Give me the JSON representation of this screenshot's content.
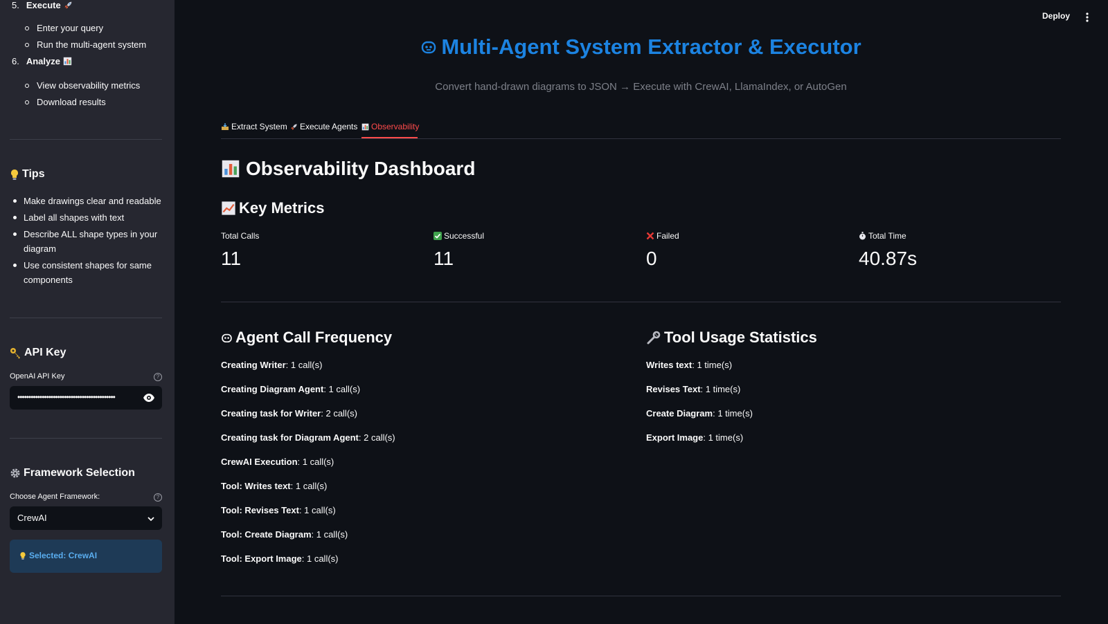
{
  "sidebar": {
    "steps": [
      {
        "num": "5.",
        "label": "Execute",
        "icon": "rocket-icon",
        "subs": [
          "Enter your query",
          "Run the multi-agent system"
        ]
      },
      {
        "num": "6.",
        "label": "Analyze",
        "icon": "bar-chart-icon",
        "subs": [
          "View observability metrics",
          "Download results"
        ]
      }
    ],
    "tips": {
      "title": "Tips",
      "icon": "lightbulb-icon",
      "items": [
        "Make drawings clear and readable",
        "Label all shapes with text",
        "Describe ALL shape types in your diagram",
        "Use consistent shapes for same components"
      ]
    },
    "api_key": {
      "title": "API Key",
      "icon": "key-icon",
      "label": "OpenAI API Key",
      "masked_value": "••••••••••••••••••••••••••••••••••••••••••••"
    },
    "framework": {
      "title": "Framework Selection",
      "icon": "gear-icon",
      "label": "Choose Agent Framework:",
      "selected": "CrewAI",
      "info": "Selected: CrewAI"
    }
  },
  "header": {
    "deploy_label": "Deploy"
  },
  "main": {
    "title": "Multi-Agent System Extractor & Executor",
    "subtitle": "Convert hand-drawn diagrams to JSON → Execute with CrewAI, LlamaIndex, or AutoGen",
    "tabs": [
      {
        "label": "Extract System",
        "icon": "inbox-tray-icon",
        "active": false
      },
      {
        "label": "Execute Agents",
        "icon": "rocket-icon",
        "active": false
      },
      {
        "label": "Observability",
        "icon": "bar-chart-icon",
        "active": true
      }
    ],
    "dashboard_title": "Observability Dashboard",
    "key_metrics_title": "Key Metrics",
    "metrics": [
      {
        "label": "Total Calls",
        "value": "11",
        "icon": ""
      },
      {
        "label": "Successful",
        "value": "11",
        "icon": "check-icon"
      },
      {
        "label": "Failed",
        "value": "0",
        "icon": "cross-icon"
      },
      {
        "label": "Total Time",
        "value": "40.87s",
        "icon": "stopwatch-icon"
      }
    ],
    "agent_freq_title": "Agent Call Frequency",
    "agent_calls": [
      {
        "name": "Creating Writer",
        "value": ": 1 call(s)"
      },
      {
        "name": "Creating Diagram Agent",
        "value": ": 1 call(s)"
      },
      {
        "name": "Creating task for Writer",
        "value": ": 2 call(s)"
      },
      {
        "name": "Creating task for Diagram Agent",
        "value": ": 2 call(s)"
      },
      {
        "name": "CrewAI Execution",
        "value": ": 1 call(s)"
      },
      {
        "name": "Tool: Writes text",
        "value": ": 1 call(s)"
      },
      {
        "name": "Tool: Revises Text",
        "value": ": 1 call(s)"
      },
      {
        "name": "Tool: Create Diagram",
        "value": ": 1 call(s)"
      },
      {
        "name": "Tool: Export Image",
        "value": ": 1 call(s)"
      }
    ],
    "tool_stats_title": "Tool Usage Statistics",
    "tool_stats": [
      {
        "name": "Writes text",
        "value": ": 1 time(s)"
      },
      {
        "name": "Revises Text",
        "value": ": 1 time(s)"
      },
      {
        "name": "Create Diagram",
        "value": ": 1 time(s)"
      },
      {
        "name": "Export Image",
        "value": ": 1 time(s)"
      }
    ]
  },
  "colors": {
    "background": "#0e1117",
    "sidebar": "#262730",
    "accent_blue": "#1c83e1",
    "active_tab": "#ff4b4b",
    "info_bg": "#1e3a56"
  }
}
